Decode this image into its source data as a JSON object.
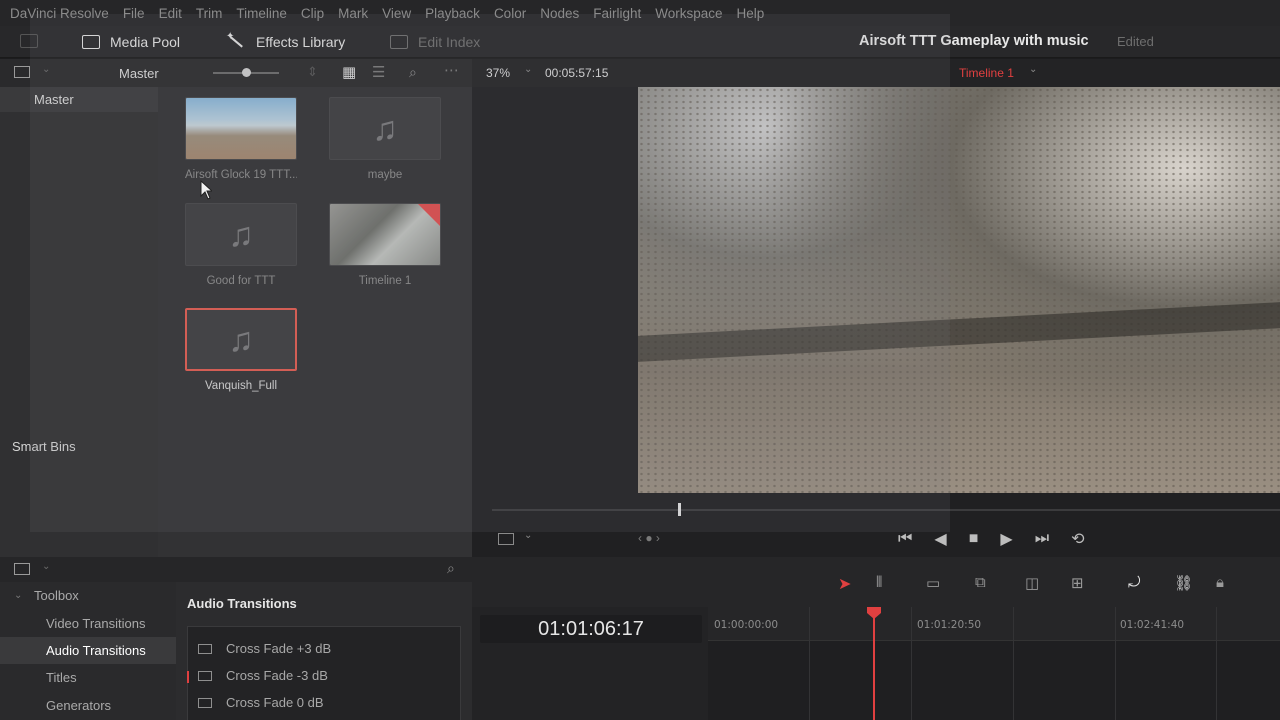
{
  "menu": [
    "DaVinci Resolve",
    "File",
    "Edit",
    "Trim",
    "Timeline",
    "Clip",
    "Mark",
    "View",
    "Playback",
    "Color",
    "Nodes",
    "Fairlight",
    "Workspace",
    "Help"
  ],
  "toolbar": {
    "media_pool": "Media Pool",
    "effects_library": "Effects Library",
    "edit_index": "Edit Index",
    "project_title": "Airsoft TTT Gameplay with music",
    "project_status": "Edited"
  },
  "media_pool": {
    "bin_header": "Master",
    "master_bin": "Master",
    "smart_bins": "Smart Bins",
    "clips": [
      {
        "name": "Airsoft Glock 19 TTT...",
        "kind": "video"
      },
      {
        "name": "maybe",
        "kind": "audio"
      },
      {
        "name": "Good for TTT",
        "kind": "audio"
      },
      {
        "name": "Timeline 1",
        "kind": "timeline"
      },
      {
        "name": "Vanquish_Full",
        "kind": "audio",
        "selected": true
      }
    ]
  },
  "viewer": {
    "zoom": "37%",
    "duration": "00:05:57:15",
    "timeline_name": "Timeline 1"
  },
  "effects": {
    "toolbox": "Toolbox",
    "tree": [
      "Video Transitions",
      "Audio Transitions",
      "Titles",
      "Generators"
    ],
    "active": "Audio Transitions",
    "panel_title": "Audio Transitions",
    "items": [
      "Cross Fade +3 dB",
      "Cross Fade -3 dB",
      "Cross Fade 0 dB"
    ]
  },
  "timeline": {
    "timecode": "01:01:06:17",
    "ruler": [
      "01:00:00:00",
      "01:01:20:50",
      "01:02:41:40"
    ]
  },
  "colors": {
    "accent_red": "#e04040",
    "selection": "#e25a4f"
  }
}
